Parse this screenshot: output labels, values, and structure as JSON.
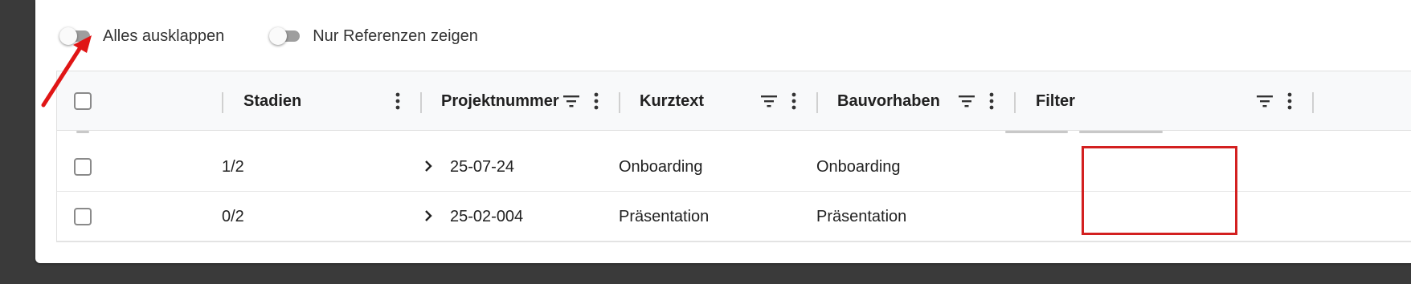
{
  "toolbar": {
    "expand_all_label": "Alles ausklappen",
    "references_only_label": "Nur Referenzen zeigen"
  },
  "table": {
    "columns": [
      {
        "title": "Stadien"
      },
      {
        "title": "Projektnummer"
      },
      {
        "title": "Kurztext"
      },
      {
        "title": "Bauvorhaben"
      },
      {
        "title": "Filter"
      }
    ],
    "rows": [
      {
        "stadien": "1/2",
        "projektnummer": "25-07-24",
        "kurztext": "Onboarding",
        "bauvorhaben": "Onboarding",
        "filter": ""
      },
      {
        "stadien": "0/2",
        "projektnummer": "25-02-004",
        "kurztext": "Präsentation",
        "bauvorhaben": "Präsentation",
        "filter": ""
      }
    ]
  },
  "colors": {
    "annotation": "#d32020",
    "header_bg": "#f8f9fa",
    "toggle_track": "#9e9e9e"
  },
  "icons": {
    "filter": "filter-lines-icon",
    "more": "more-vertical-icon",
    "expand": "chevron-right-icon"
  }
}
